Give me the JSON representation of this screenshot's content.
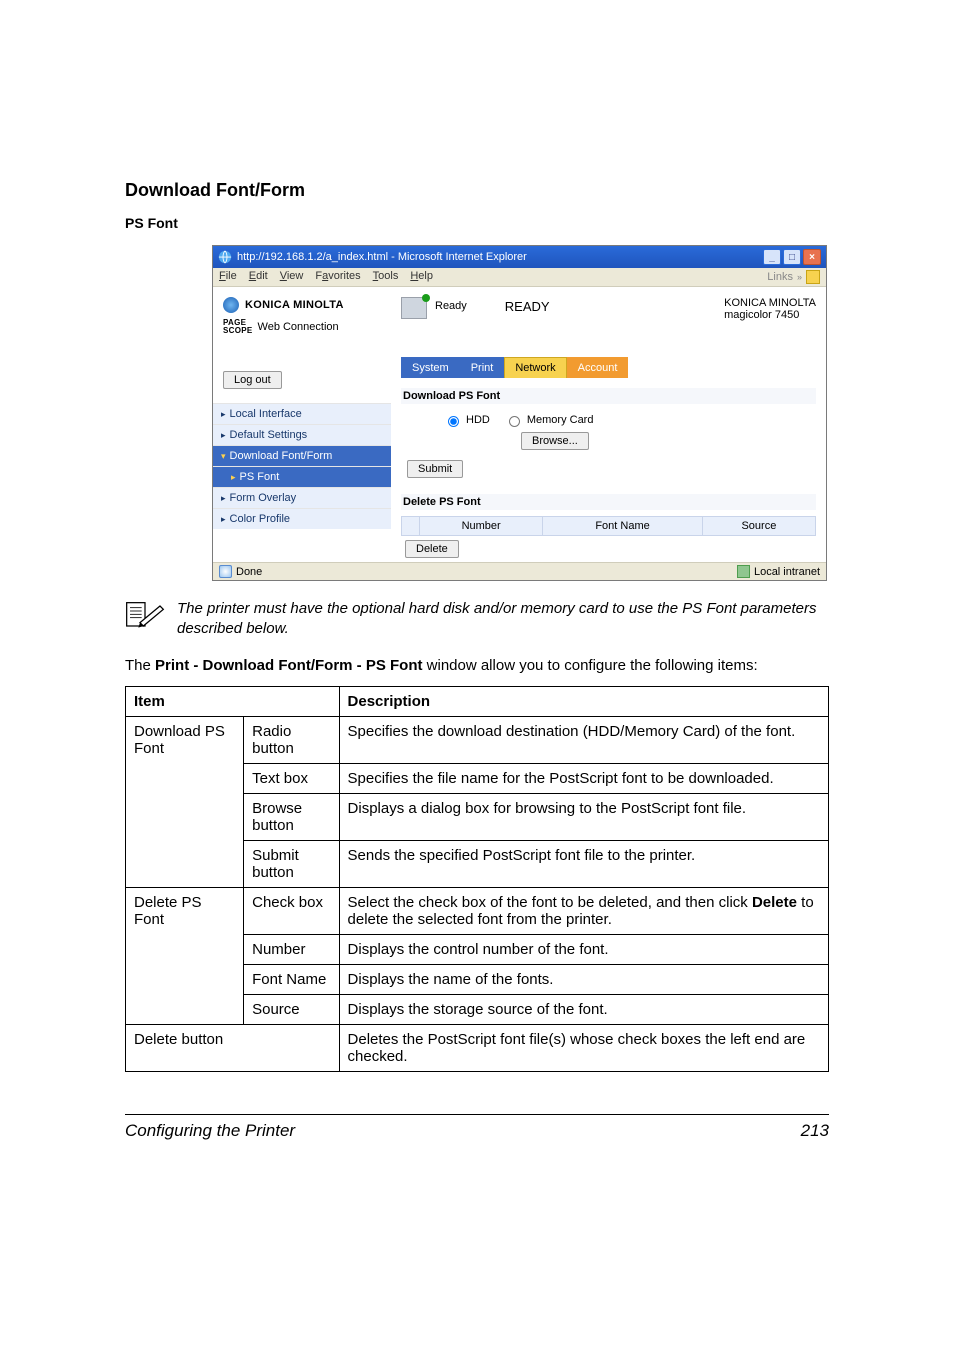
{
  "heading": "Download Font/Form",
  "sub_heading": "PS Font",
  "browser": {
    "title": "http://192.168.1.2/a_index.html - Microsoft Internet Explorer",
    "menu": {
      "file": "File",
      "edit": "Edit",
      "view": "View",
      "favorites": "Favorites",
      "tools": "Tools",
      "help": "Help",
      "links": "Links"
    },
    "status": {
      "done": "Done",
      "zone": "Local intranet"
    }
  },
  "app": {
    "brand": "KONICA MINOLTA",
    "ps1": "PAGE",
    "ps2": "SCOPE",
    "webconn": "Web Connection",
    "logout": "Log out",
    "ready_small": "Ready",
    "ready_big": "READY",
    "company": "KONICA MINOLTA",
    "product": "magicolor 7450",
    "tabs": {
      "system": "System",
      "print": "Print",
      "network": "Network",
      "account": "Account"
    },
    "nav": {
      "local": "Local Interface",
      "default": "Default Settings",
      "download": "Download Font/Form",
      "ps": "PS Font",
      "form": "Form Overlay",
      "color": "Color Profile"
    },
    "panel": {
      "title1": "Download PS Font",
      "hdd": "HDD",
      "mem": "Memory Card",
      "browse": "Browse...",
      "submit": "Submit",
      "title2": "Delete PS Font",
      "col_number": "Number",
      "col_font": "Font Name",
      "col_source": "Source",
      "delete": "Delete"
    }
  },
  "note": "The printer must have the optional hard disk and/or memory card to use the PS Font parameters described below.",
  "body_pre": "The ",
  "body_bold": "Print - Download Font/Form - PS Font",
  "body_post": " window allow you to configure the following items:",
  "table": {
    "h_item": "Item",
    "h_desc": "Description",
    "rows": [
      {
        "item": "Download PS Font",
        "sub": "Radio button",
        "desc": "Specifies the download destination (HDD/Memory Card) of the font."
      },
      {
        "item": "",
        "sub": "Text box",
        "desc": "Specifies the file name for the PostScript font to be downloaded."
      },
      {
        "item": "",
        "sub": "Browse button",
        "desc": "Displays a dialog box for browsing to the PostScript font file."
      },
      {
        "item": "",
        "sub": "Submit button",
        "desc": "Sends the specified PostScript font file to the printer."
      },
      {
        "item": "Delete PS Font",
        "sub": "Check box",
        "desc_pre": "Select the check box of the font to be deleted, and then click ",
        "desc_bold": "Delete",
        "desc_post": " to delete the selected font from the printer."
      },
      {
        "item": "",
        "sub": "Number",
        "desc": "Displays the control number of the font."
      },
      {
        "item": "",
        "sub": "Font Name",
        "desc": "Displays the name of the fonts."
      },
      {
        "item": "",
        "sub": "Source",
        "desc": "Displays the storage source of the font."
      },
      {
        "item": "Delete button",
        "sub": "",
        "desc": "Deletes the PostScript font file(s) whose check boxes the left end are checked."
      }
    ]
  },
  "footer": {
    "title": "Configuring the Printer",
    "page": "213"
  }
}
